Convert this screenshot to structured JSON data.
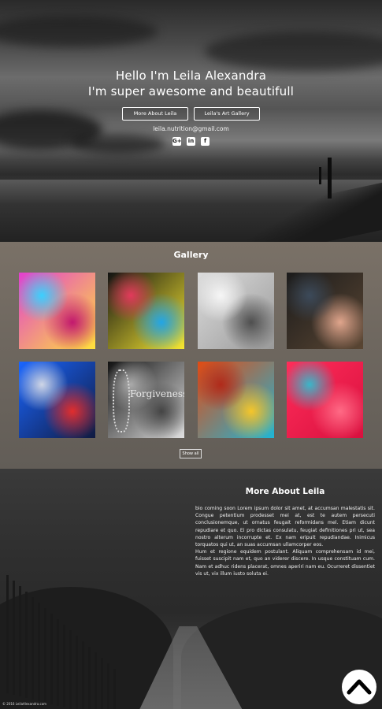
{
  "hero": {
    "title_line1": "Hello I'm Leila Alexandra",
    "title_line2": "I'm super awesome and beautifull",
    "buttons": [
      {
        "label": "More About Leila"
      },
      {
        "label": "Leila's Art Gallery"
      }
    ],
    "email": "leila.nutrition@gmail.com",
    "social": [
      {
        "icon": "google-plus-icon",
        "glyph": "G+"
      },
      {
        "icon": "linkedin-icon",
        "glyph": "in"
      },
      {
        "icon": "facebook-icon",
        "glyph": "f"
      }
    ]
  },
  "gallery": {
    "title": "Gallery",
    "show_all_label": "Show all",
    "items": [
      {
        "name": "gallery-image-1",
        "colors": [
          "#e23fd0",
          "#ffe23a",
          "#c2186e",
          "#3ad0ff"
        ]
      },
      {
        "name": "gallery-image-2",
        "colors": [
          "#121212",
          "#f7e832",
          "#22a5e6",
          "#e23a5b"
        ]
      },
      {
        "name": "gallery-image-3",
        "colors": [
          "#dcdcdc",
          "#9a9a9a",
          "#4f4f4f",
          "#f6f6f6"
        ]
      },
      {
        "name": "gallery-image-4",
        "colors": [
          "#1b1b1b",
          "#5a4633",
          "#e0a58c",
          "#3c4a5a"
        ]
      },
      {
        "name": "gallery-image-5",
        "colors": [
          "#1a66ff",
          "#101a40",
          "#e22d2d",
          "#cfd6e6"
        ]
      },
      {
        "name": "gallery-image-6",
        "colors": [
          "#111111",
          "#e0e0e0",
          "#444444",
          "#aaaaaa"
        ],
        "caption": "Forgiveness"
      },
      {
        "name": "gallery-image-7",
        "colors": [
          "#e24a12",
          "#1eb6d6",
          "#f5c52a",
          "#b02a1a"
        ]
      },
      {
        "name": "gallery-image-8",
        "colors": [
          "#ff2d5a",
          "#d8103e",
          "#ff6a85",
          "#3ab6c9"
        ]
      }
    ]
  },
  "about": {
    "title": "More About Leila",
    "paragraph1": "bio coming soon Lorem ipsum dolor sit amet, at accumsan malestatis sit. Congue petentium prodesset mei at, est te autem persecuti conclusionemque, ut ornatus feugait reformidans mel. Etiam dicunt repudiare et quo. Ei pro dictas consulatu, feugiat definitiones pri ut, sea nostro alterum incorrupte et. Ex nam eripuit repudiandae. Inimicus torquatos qui ut, an suas accumsan ullamcorper eos.",
    "paragraph2": "Hum et regione equidem postulant. Aliquam comprehensam id mei, fuisset suscipit nam et, quo an viderer discere. In usque constituam cum. Nam et adhuc ridens placerat, omnes aperiri nam eu. Ocurreret dissentiet vis ut, vix illum iusto soluta ei."
  },
  "footer": {
    "copyright": "© 2016 LeilaAlexandra.com"
  },
  "colors": {
    "gallery_bg": "#6e675f",
    "about_bg": "#2f2f2f",
    "text": "#ffffff"
  }
}
